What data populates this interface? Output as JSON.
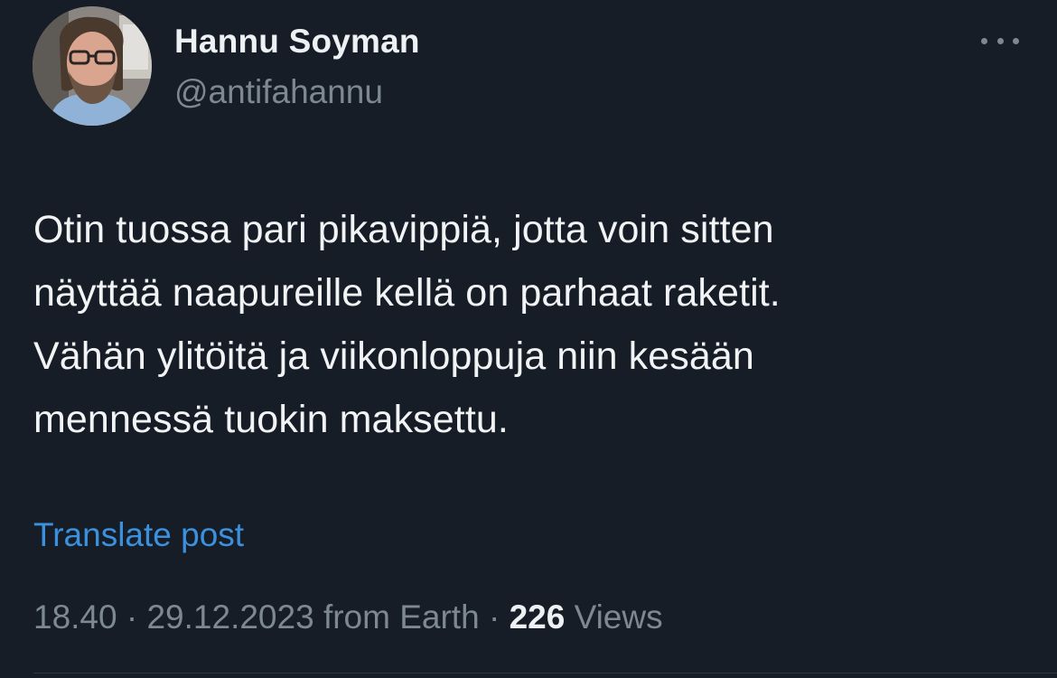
{
  "author": {
    "display_name": "Hannu Soyman",
    "handle": "@antifahannu"
  },
  "post": {
    "lines": [
      "Otin tuossa pari pikavippiä, jotta voin sitten",
      "näyttää naapureille kellä on parhaat raketit.",
      "Vähän ylitöitä ja viikonloppuja niin kesään",
      "mennessä tuokin maksettu."
    ],
    "translate_label": "Translate post"
  },
  "meta": {
    "time": "18.40",
    "separator": "·",
    "date": "29.12.2023",
    "source": "from Earth",
    "views_count": "226",
    "views_label": "Views"
  },
  "icons": {
    "more": "more-horizontal-icon",
    "avatar": "profile-photo"
  },
  "colors": {
    "background": "#161d27",
    "primary_text": "#f1f3f5",
    "secondary_text": "#7d8893",
    "link": "#3b91de"
  }
}
